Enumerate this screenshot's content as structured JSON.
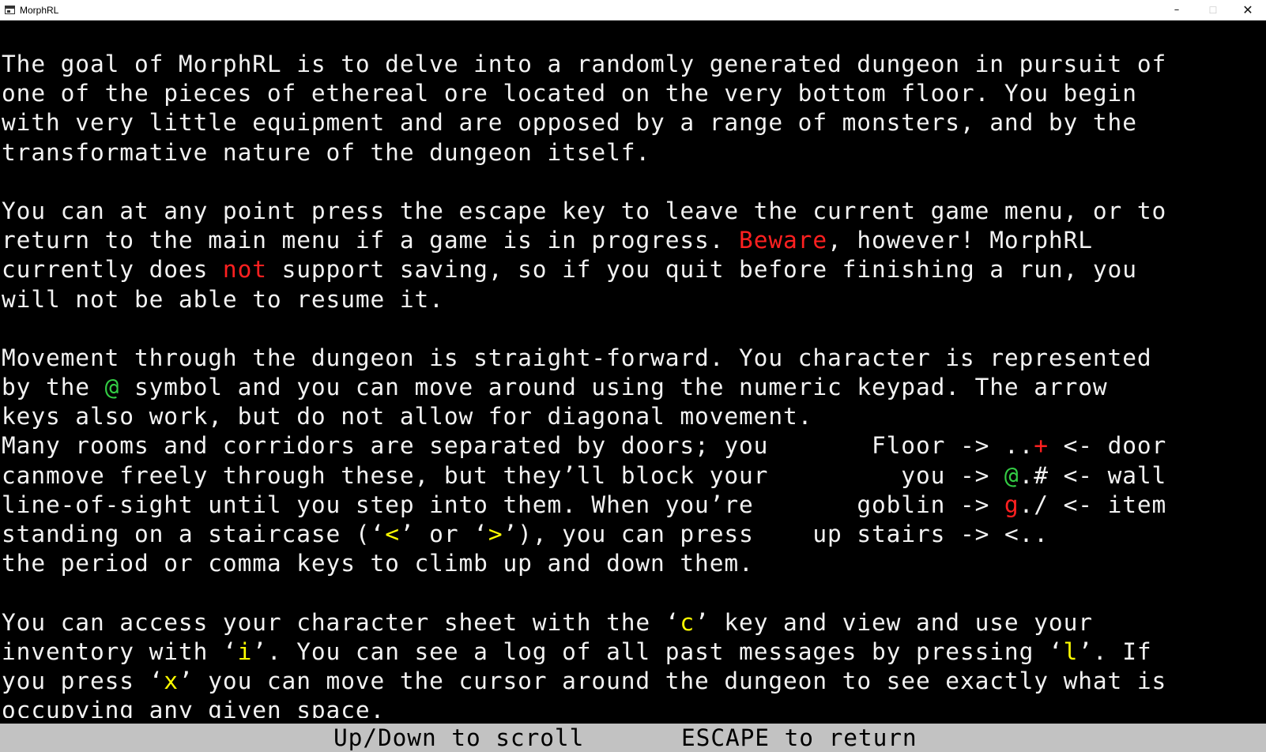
{
  "window": {
    "title": "MorphRL",
    "minimize": "–",
    "maximize": "☐",
    "close": "✕"
  },
  "icons": [
    "console-icon",
    "minimize-icon",
    "maximize-icon",
    "close-icon"
  ],
  "colors": {
    "background": "#000000",
    "text": "#f2f2f2",
    "warning_red": "#ff2020",
    "player_green": "#33cc44",
    "key_yellow": "#ffff00",
    "status_bar": "#c2c2c2"
  },
  "help": {
    "intro": [
      "The goal of MorphRL is to delve into a randomly generated dungeon in pursuit of",
      "one of the pieces of ethereal ore located on the very bottom floor. You begin",
      "with very little equipment and are opposed by a range of monsters, and by the",
      "transformative nature of the dungeon itself."
    ],
    "escape": {
      "line1": "You can at any point press the escape key to leave the current game menu, or to",
      "line2_pre": "return to the main menu if a game is in progress. ",
      "line2_beware": "Beware",
      "line2_post": ", however! MorphRL",
      "line3_pre": "currently does ",
      "line3_not": "not",
      "line3_post": " support saving, so if you quit before finishing a run, you",
      "line4": "will not be able to resume it."
    },
    "movement": {
      "line1": "Movement through the dungeon is straight-forward. You character is represented",
      "line2_pre": "by the ",
      "line2_at": "@",
      "line2_post": " symbol and you can move around using the numeric keypad. The arrow",
      "line3": "keys also work, but do not allow for diagonal movement."
    },
    "doors": {
      "line1_text": "Many rooms and corridors are separated by doors; you       ",
      "line1_label": "Floor -> ",
      "line1_floor": "..",
      "line1_door": "+",
      "line1_end": " <- door",
      "line2_text": "canmove freely through these, but they’ll block your         ",
      "line2_label": "you -> ",
      "line2_at": "@",
      "line2_dot": ".",
      "line2_wall": "#",
      "line2_end": " <- wall",
      "line3_text": "line-of-sight until you step into them. When you’re       ",
      "line3_label": "goblin -> ",
      "line3_g": "g",
      "line3_dot": ".",
      "line3_item": "/",
      "line3_end": " <- item",
      "line4_pre": "standing on a staircase (‘",
      "line4_lt": "<",
      "line4_mid": "’ or ‘",
      "line4_gt": ">",
      "line4_post": "’), you can press    ",
      "line4_label": "up stairs -> ",
      "line4_stairs": "<..",
      "line5": "the period or comma keys to climb up and down them."
    },
    "misc": {
      "line1_pre": "You can access your character sheet with the ‘",
      "line1_c": "c",
      "line1_post": "’ key and view and use your",
      "line2_pre": "inventory with ‘",
      "line2_i": "i",
      "line2_mid": "’. You can see a log of all past messages by pressing ‘",
      "line2_l": "l",
      "line2_post": "’. If",
      "line3_pre": "you press ‘",
      "line3_x": "x",
      "line3_post": "’ you can move the cursor around the dungeon to see exactly what is",
      "line4": "occupying any given space."
    }
  },
  "status": {
    "scroll": "Up/Down to scroll",
    "escape": "ESCAPE to return"
  }
}
